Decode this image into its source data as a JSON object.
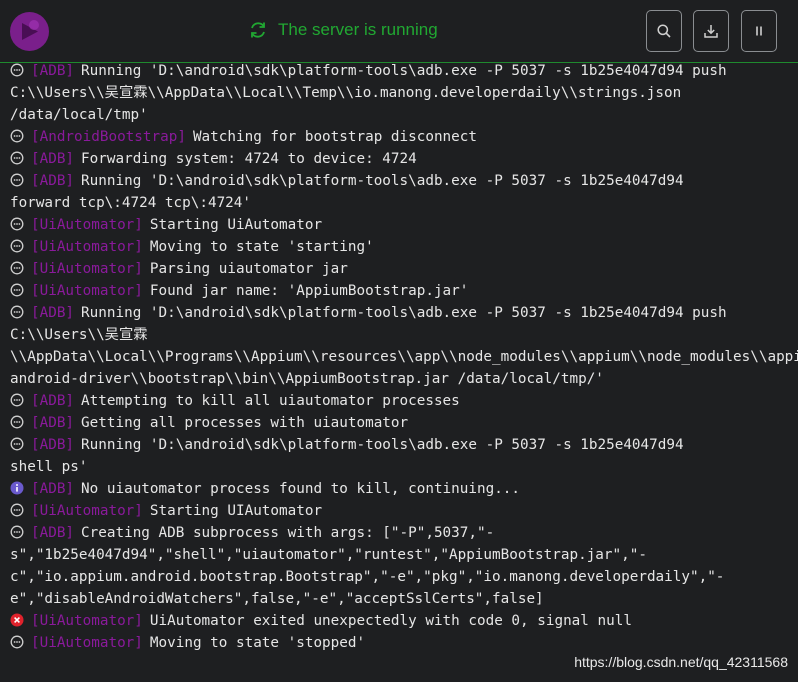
{
  "header": {
    "status_text": "The server is running",
    "status_color": "#21a832",
    "icons": {
      "logo": "appium-logo",
      "status": "refresh-icon",
      "search": "search-icon",
      "download": "download-icon",
      "pause": "pause-icon"
    }
  },
  "colors": {
    "tag": "#8a1a9b",
    "info_icon": "#6a5acd",
    "error_icon": "#e0222c",
    "divider": "#1f8a2e"
  },
  "log": {
    "entries": [
      {
        "icon": "chat",
        "tag": "[ADB]",
        "lines": [
          "Running 'D:\\android\\sdk\\platform-tools\\adb.exe -P 5037 -s 1b25e4047d94 push",
          "C:\\\\Users\\\\吴宣霖\\\\AppData\\\\Local\\\\Temp\\\\io.manong.developerdaily\\\\strings.json",
          "/data/local/tmp'"
        ]
      },
      {
        "icon": "chat",
        "tag": "[AndroidBootstrap]",
        "lines": [
          "Watching for bootstrap disconnect"
        ]
      },
      {
        "icon": "chat",
        "tag": "[ADB]",
        "lines": [
          "Forwarding system: 4724 to device: 4724"
        ]
      },
      {
        "icon": "chat",
        "tag": "[ADB]",
        "lines": [
          "Running 'D:\\android\\sdk\\platform-tools\\adb.exe -P 5037 -s 1b25e4047d94",
          "forward tcp\\:4724 tcp\\:4724'"
        ]
      },
      {
        "icon": "chat",
        "tag": "[UiAutomator]",
        "lines": [
          "Starting UiAutomator"
        ]
      },
      {
        "icon": "chat",
        "tag": "[UiAutomator]",
        "lines": [
          "Moving to state 'starting'"
        ]
      },
      {
        "icon": "chat",
        "tag": "[UiAutomator]",
        "lines": [
          "Parsing uiautomator jar"
        ]
      },
      {
        "icon": "chat",
        "tag": "[UiAutomator]",
        "lines": [
          "Found jar name: 'AppiumBootstrap.jar'"
        ]
      },
      {
        "icon": "chat",
        "tag": "[ADB]",
        "lines": [
          "Running 'D:\\android\\sdk\\platform-tools\\adb.exe -P 5037 -s 1b25e4047d94 push",
          "C:\\\\Users\\\\吴宣霖",
          "\\\\AppData\\\\Local\\\\Programs\\\\Appium\\\\resources\\\\app\\\\node_modules\\\\appium\\\\node_modules\\\\appium-",
          "android-driver\\\\bootstrap\\\\bin\\\\AppiumBootstrap.jar /data/local/tmp/'"
        ]
      },
      {
        "icon": "chat",
        "tag": "[ADB]",
        "lines": [
          "Attempting to kill all uiautomator processes"
        ]
      },
      {
        "icon": "chat",
        "tag": "[ADB]",
        "lines": [
          "Getting all processes with uiautomator"
        ]
      },
      {
        "icon": "chat",
        "tag": "[ADB]",
        "lines": [
          "Running 'D:\\android\\sdk\\platform-tools\\adb.exe -P 5037 -s 1b25e4047d94",
          "shell ps'"
        ]
      },
      {
        "icon": "info",
        "tag": "[ADB]",
        "lines": [
          "No uiautomator process found to kill, continuing..."
        ]
      },
      {
        "icon": "chat",
        "tag": "[UiAutomator]",
        "lines": [
          "Starting UIAutomator"
        ]
      },
      {
        "icon": "chat",
        "tag": "[ADB]",
        "lines": [
          "Creating ADB subprocess with args: [\"-P\",5037,\"-",
          "s\",\"1b25e4047d94\",\"shell\",\"uiautomator\",\"runtest\",\"AppiumBootstrap.jar\",\"-",
          "c\",\"io.appium.android.bootstrap.Bootstrap\",\"-e\",\"pkg\",\"io.manong.developerdaily\",\"-",
          "e\",\"disableAndroidWatchers\",false,\"-e\",\"acceptSslCerts\",false]"
        ]
      },
      {
        "icon": "error",
        "tag": "[UiAutomator]",
        "lines": [
          "UiAutomator exited unexpectedly with code 0, signal null"
        ]
      },
      {
        "icon": "chat",
        "tag": "[UiAutomator]",
        "lines": [
          "Moving to state 'stopped'"
        ]
      }
    ]
  },
  "watermark": "https://blog.csdn.net/qq_42311568"
}
